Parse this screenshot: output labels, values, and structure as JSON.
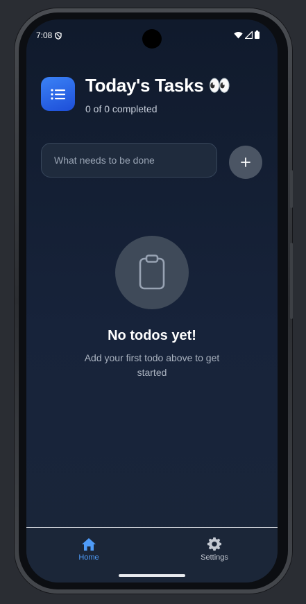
{
  "status_bar": {
    "time": "7:08",
    "left_icon": "shield-icon",
    "right_icons": [
      "wifi-icon",
      "cell-signal-icon",
      "battery-icon"
    ]
  },
  "header": {
    "app_icon": "list-icon",
    "title": "Today's Tasks 👀",
    "subtitle": "0 of 0 completed"
  },
  "input": {
    "placeholder": "What needs to be done",
    "value": ""
  },
  "add_button": {
    "icon": "plus-icon"
  },
  "empty_state": {
    "icon": "clipboard-icon",
    "title": "No todos yet!",
    "description": "Add your first todo above to get started"
  },
  "bottom_nav": {
    "items": [
      {
        "label": "Home",
        "icon": "home-icon",
        "active": true
      },
      {
        "label": "Settings",
        "icon": "gear-icon",
        "active": false
      }
    ]
  },
  "colors": {
    "accent": "#3b82f6",
    "active_nav": "#4f9cf9",
    "inactive_nav": "#c4c9d2",
    "background": "#131e32"
  }
}
